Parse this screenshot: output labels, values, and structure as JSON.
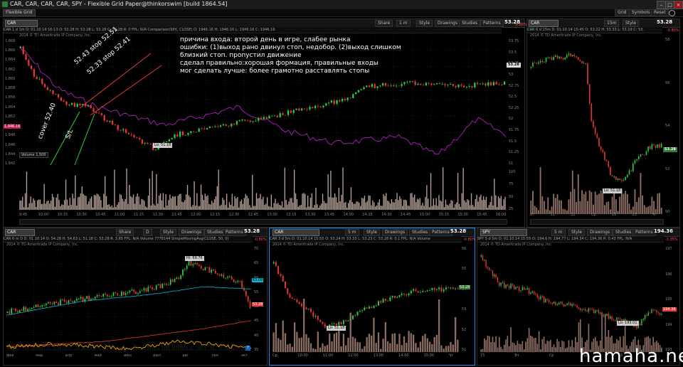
{
  "window": {
    "title": "CAR, CAR, CAR, CAR, SPY - Flexible Grid Paper@thinkorswim [build 1864.54]",
    "tab": "Flexible Grid",
    "buttons": [
      "Grid",
      "Symbols",
      "Reset"
    ]
  },
  "toolbar": {
    "share": "Share",
    "style": "Style",
    "drawings": "Drawings",
    "studies": "Studies",
    "patterns": "Patterns"
  },
  "main_chart": {
    "symbol": "CAR",
    "aggregation": "1 m",
    "info": "CAR 1 d 1m  D: 01.10.14 16:13  O: 53.28  H: 53.28  L: 53.28  C: 53.28  R: 0  FPL: N/A   Comparison(SPX, CLOSE)  O: 1946.16  H: 1946.16  L: 1946.16  C: 1946.16",
    "price": "53.28",
    "change": "-0.80%",
    "company": "2014 © TD Ameritrade IP Company, Inc.",
    "left_axis": [
      "1,868",
      "1,866",
      "1,864",
      "1,862",
      "1,860",
      "1,858",
      "1,856",
      "1,854",
      "1,852",
      "1,850",
      "1,848",
      "1,846",
      "1,844",
      "1,842"
    ],
    "left_price_tag": "1,946.16",
    "right_axis": [
      "53.75",
      "53.5",
      "53.25",
      "53",
      "52.75",
      "52.5",
      "52.25",
      "52",
      "51.75",
      "51.5",
      "51.25",
      "51"
    ],
    "low_label": "Lo: 51.18",
    "volume_label": "Volume",
    "volume_value": "1,500",
    "vol_axis": [
      "100",
      "75",
      "50",
      "25"
    ],
    "times": [
      "9:45",
      "10:00",
      "10:15",
      "10:30",
      "10:45",
      "11:00",
      "11:15",
      "11:30",
      "11:45",
      "12:00",
      "12:15",
      "12:30",
      "12:45",
      "13:00",
      "13:15",
      "13:30",
      "13:45",
      "14:00",
      "14:15",
      "14:30",
      "14:45",
      "15:00",
      "15:15",
      "15:30",
      "15:45",
      "16:00"
    ],
    "annotations": {
      "line1": "причина входа: второй день в игре, слабее рынка",
      "line2": "ошибки: (1)выход рано двинул стоп, недобор. (2)выход слишком",
      "line3": "близкий стоп. пропустил движение",
      "line4": "сделал правильно:хорошая формация, правильные входы",
      "line5": "мог сделать лучше: более грамотно расставлять стопы",
      "stop1": "52.43 stop 52.51",
      "stop2": "52.33 stop 52.41",
      "cover": "cover 52.40",
      "sl": "S/L"
    }
  },
  "right_top_chart": {
    "symbol": "CAR",
    "aggregation": "15m",
    "info": "CAR 6 d 15m  D: 01.10.14 15:45  O: 53.22  H: 53.33  L: 53.19  C: 53.",
    "price": "53.28",
    "change": "-0.80%",
    "company": "2014 © TD Ameritrade IP Company, Inc.",
    "axis": [
      "58",
      "56",
      "54",
      "52",
      "50"
    ],
    "low_label": "Lo: 51.18",
    "days": [
      "Вт",
      "11",
      "12",
      "Ср",
      "11",
      "13",
      "Чт"
    ]
  },
  "bottom_left_chart": {
    "symbol": "CAR",
    "aggregation": "D",
    "info": "CAR 6 m D  D: 01.10.14  O: 54.28  H: 54.63  L: 51.18  C: 53.28  R: 3.65  FPL: N/A   Volume 7778144   SimpleMovingAvg(CLOSE, 50, 0)",
    "price": "53.28",
    "change": "-0.80%",
    "company": "2014 © TD Ameritrade IP Company, Inc.",
    "high_label": "Hi: 69.76",
    "ma_tag": "63.09",
    "axis": [
      "70",
      "65",
      "60",
      "55",
      "50",
      "45",
      "40",
      "35"
    ],
    "months": [
      "фев",
      "мар",
      "апр",
      "май",
      "июн",
      "июл",
      "авг",
      "сен",
      "окт"
    ]
  },
  "bottom_mid_chart": {
    "symbol": "CAR",
    "aggregation": "5 m",
    "info": "CAR 3 d 5m  D: 01.10.14 15:55  O: 53.24  H: 53.33  L: 53.23  C: 53.28  R: 0.1  FPL: N/A   Volume",
    "price": "53.28",
    "change": "-0.80%",
    "company": "2014 © TD Ameritrade IP Company, Inc.",
    "low_label": "Lo: 51.18",
    "axis": [
      "56",
      "55",
      "54",
      "53",
      "52",
      "51"
    ],
    "times": [
      "Ср",
      "10:00",
      "11:00",
      "12:00",
      "13:00",
      "14:00",
      "15:00",
      "Чт"
    ]
  },
  "bottom_right_chart": {
    "symbol": "SPY",
    "aggregation": "5 m",
    "info": "SPY 5 d 5m  D: 01.10.14 15:55  O: 194.6  H: 194.77  L: 194.34  C: 194.36  R: 0.43  FPL: N/A",
    "price": "194.36",
    "change": "-1.35%",
    "company": "2014 © TD Ameritrade IP Company, Inc.",
    "low_label": "Lo: 193.01",
    "axis": [
      "197",
      "196",
      "195",
      "194",
      "193"
    ],
    "days": [
      "15",
      "Вт",
      "Ср",
      "12",
      "13",
      "Чт"
    ]
  },
  "watermark": "hamaha.net"
}
